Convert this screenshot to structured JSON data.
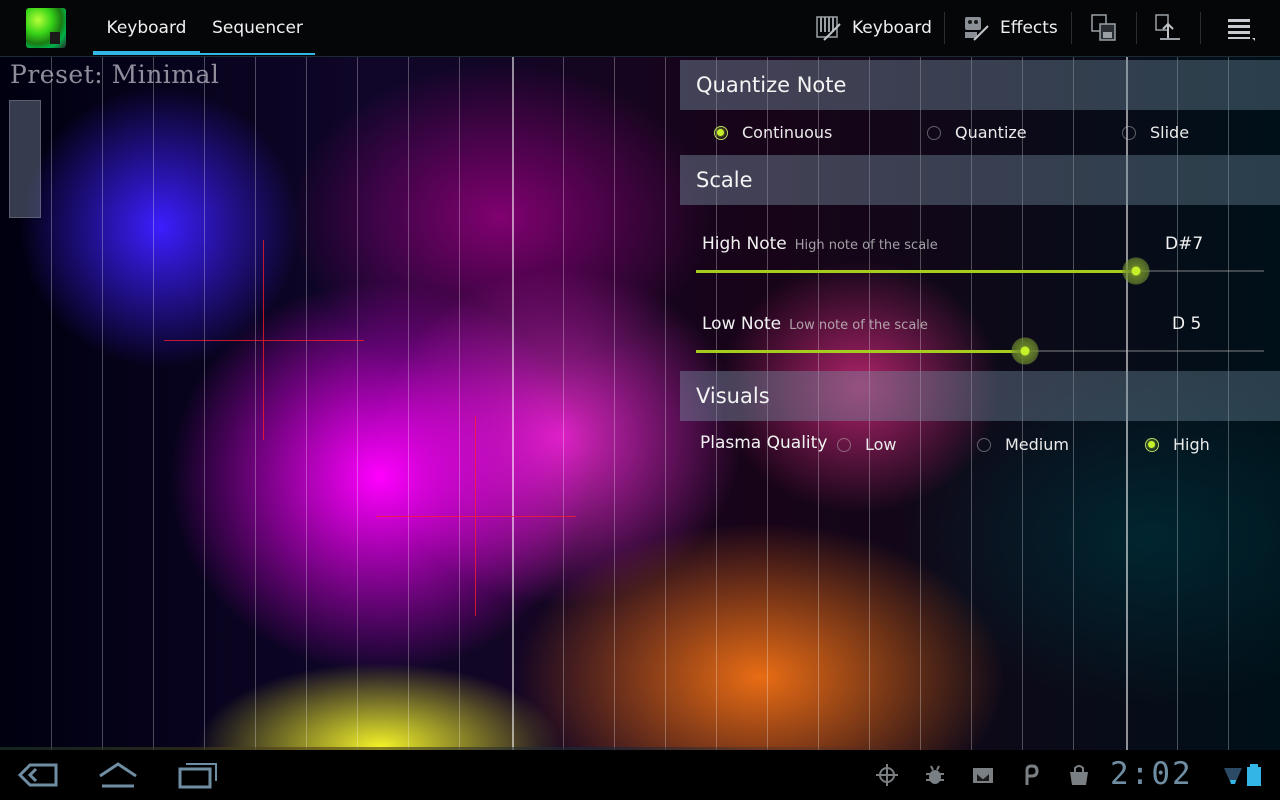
{
  "tabs": [
    {
      "label": "Keyboard",
      "selected": true
    },
    {
      "label": "Sequencer",
      "selected": false
    }
  ],
  "actions": {
    "keyboard_label": "Keyboard",
    "effects_label": "Effects",
    "icons": [
      "keyboard-icon",
      "effects-icon",
      "save-preset-icon",
      "load-preset-icon",
      "overflow-menu-icon"
    ]
  },
  "preset": {
    "label": "Preset: Minimal"
  },
  "quantize": {
    "header": "Quantize Note",
    "options": [
      {
        "label": "Continuous",
        "selected": true
      },
      {
        "label": "Quantize",
        "selected": false
      },
      {
        "label": "Slide",
        "selected": false
      }
    ]
  },
  "scale": {
    "header": "Scale",
    "high": {
      "title": "High Note",
      "summary": "High note of the scale",
      "value": "D#7",
      "level": 0.775
    },
    "low": {
      "title": "Low Note",
      "summary": "Low note of the scale",
      "value": "D 5",
      "level": 0.58
    }
  },
  "visuals": {
    "header": "Visuals",
    "plasma_label": "Plasma Quality",
    "options": [
      {
        "label": "Low",
        "selected": false
      },
      {
        "label": "Medium",
        "selected": false
      },
      {
        "label": "High",
        "selected": true
      }
    ]
  },
  "system": {
    "clock": "2:02",
    "nav_icons": [
      "back-icon",
      "home-icon",
      "recent-apps-icon"
    ],
    "status_icons": [
      "gps-icon",
      "debug-icon",
      "gmail-icon",
      "p-app-icon",
      "shopping-bag-icon",
      "wifi-icon",
      "battery-icon"
    ]
  },
  "colors": {
    "accent": "#33b5e5",
    "slider": "#a6cc1e",
    "radio_on": "#c6f02a",
    "clock": "#6f8ea3"
  }
}
